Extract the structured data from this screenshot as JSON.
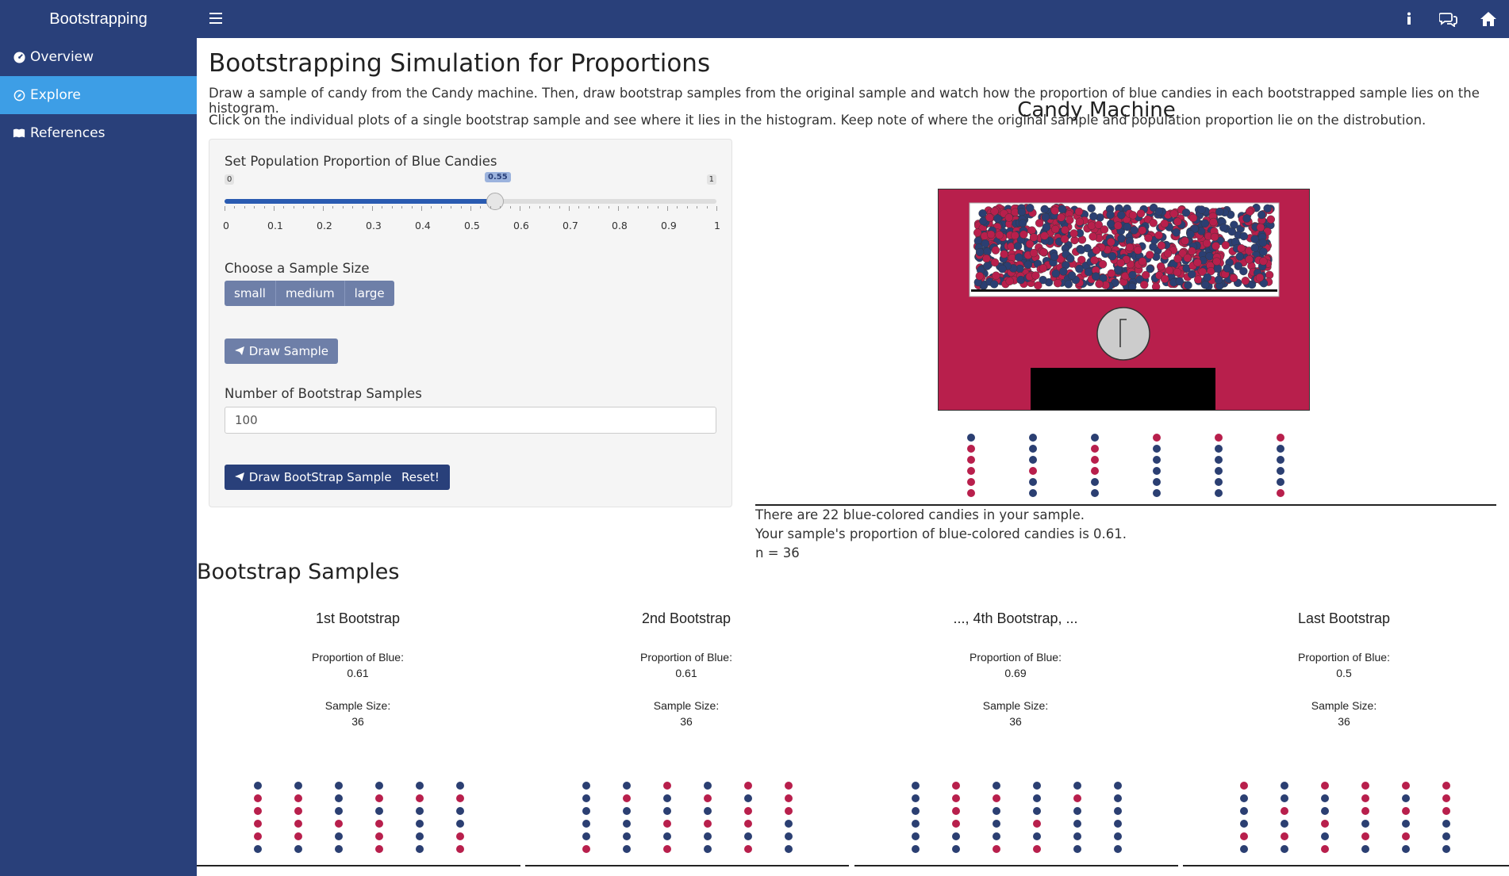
{
  "app": {
    "title": "Bootstrapping"
  },
  "nav": [
    {
      "label": "Overview",
      "icon": "dashboard-icon",
      "active": false
    },
    {
      "label": "Explore",
      "icon": "compass-icon",
      "active": true
    },
    {
      "label": "References",
      "icon": "book-icon",
      "active": false
    }
  ],
  "header_icons": [
    "info-icon",
    "comments-icon",
    "home-icon"
  ],
  "page": {
    "title": "Bootstrapping Simulation for Proportions",
    "desc1": "Draw a sample of candy from the Candy machine. Then, draw bootstrap samples from the original sample and watch how the proportion of blue candies in each bootstrapped sample lies on the histogram.",
    "desc2": "Click on the individual plots of a single bootstrap sample and see where it lies in the histogram. Keep note of where the original sample and population proportion lie on the distrobution."
  },
  "controls": {
    "proportion_label": "Set Population Proportion of Blue Candies",
    "slider": {
      "min": 0,
      "max": 1,
      "value": 0.55,
      "min_label": "0",
      "max_label": "1",
      "value_label": "0.55",
      "ticks": [
        "0",
        "0.1",
        "0.2",
        "0.3",
        "0.4",
        "0.5",
        "0.6",
        "0.7",
        "0.8",
        "0.9",
        "1"
      ]
    },
    "sample_size_label": "Choose a Sample Size",
    "sample_sizes": [
      "small",
      "medium",
      "large"
    ],
    "draw_sample": "Draw Sample",
    "num_boot_label": "Number of Bootstrap Samples",
    "num_boot_value": "100",
    "draw_boot": "Draw BootStrap Samples",
    "reset": "Reset!"
  },
  "machine": {
    "title": "Candy Machine",
    "line1": "There are 22 blue-colored candies in your sample.",
    "line2": "Your sample's proportion of blue-colored candies is 0.61.",
    "line3": "n = 36"
  },
  "colors": {
    "blue": "#2b3f72",
    "red": "#b81f4c",
    "machine": "#b81f4c",
    "nav": "#29407a",
    "active": "#3d9ee6"
  },
  "sample_dots": [
    [
      "b",
      "r",
      "r",
      "r",
      "r",
      "r"
    ],
    [
      "b",
      "b",
      "b",
      "r",
      "b",
      "b"
    ],
    [
      "b",
      "r",
      "r",
      "r",
      "b",
      "b"
    ],
    [
      "r",
      "b",
      "b",
      "b",
      "b",
      "b"
    ],
    [
      "r",
      "b",
      "b",
      "b",
      "b",
      "b"
    ],
    [
      "r",
      "b",
      "b",
      "b",
      "b",
      "r"
    ]
  ],
  "bootstrap": {
    "section_title": "Bootstrap Samples",
    "prop_label": "Proportion of Blue:",
    "size_label": "Sample Size:",
    "samples": [
      {
        "title": "1st Bootstrap",
        "proportion": "0.61",
        "size": "36",
        "dots": [
          [
            "b",
            "r",
            "r",
            "r",
            "r",
            "b"
          ],
          [
            "b",
            "r",
            "r",
            "r",
            "r",
            "b"
          ],
          [
            "b",
            "b",
            "b",
            "r",
            "b",
            "b"
          ],
          [
            "b",
            "r",
            "b",
            "r",
            "r",
            "r"
          ],
          [
            "b",
            "r",
            "b",
            "b",
            "b",
            "b"
          ],
          [
            "b",
            "r",
            "b",
            "b",
            "r",
            "r"
          ]
        ]
      },
      {
        "title": "2nd Bootstrap",
        "proportion": "0.61",
        "size": "36",
        "dots": [
          [
            "b",
            "b",
            "b",
            "b",
            "b",
            "r"
          ],
          [
            "b",
            "r",
            "b",
            "b",
            "b",
            "b"
          ],
          [
            "r",
            "b",
            "b",
            "r",
            "b",
            "r"
          ],
          [
            "b",
            "r",
            "b",
            "r",
            "b",
            "b"
          ],
          [
            "r",
            "b",
            "r",
            "r",
            "b",
            "r"
          ],
          [
            "r",
            "r",
            "r",
            "b",
            "b",
            "b"
          ]
        ]
      },
      {
        "title": "..., 4th Bootstrap, ...",
        "proportion": "0.69",
        "size": "36",
        "dots": [
          [
            "b",
            "b",
            "b",
            "b",
            "b",
            "b"
          ],
          [
            "r",
            "r",
            "r",
            "r",
            "b",
            "b"
          ],
          [
            "b",
            "r",
            "b",
            "b",
            "b",
            "r"
          ],
          [
            "b",
            "b",
            "b",
            "r",
            "b",
            "r"
          ],
          [
            "b",
            "r",
            "b",
            "b",
            "b",
            "b"
          ],
          [
            "b",
            "b",
            "b",
            "b",
            "b",
            "b"
          ]
        ]
      },
      {
        "title": "Last Bootstrap",
        "proportion": "0.5",
        "size": "36",
        "dots": [
          [
            "r",
            "b",
            "b",
            "b",
            "r",
            "b"
          ],
          [
            "b",
            "b",
            "r",
            "b",
            "r",
            "b"
          ],
          [
            "r",
            "b",
            "b",
            "r",
            "b",
            "r"
          ],
          [
            "r",
            "r",
            "r",
            "b",
            "r",
            "b"
          ],
          [
            "r",
            "b",
            "r",
            "b",
            "r",
            "b"
          ],
          [
            "r",
            "r",
            "r",
            "b",
            "b",
            "b"
          ]
        ]
      }
    ]
  }
}
